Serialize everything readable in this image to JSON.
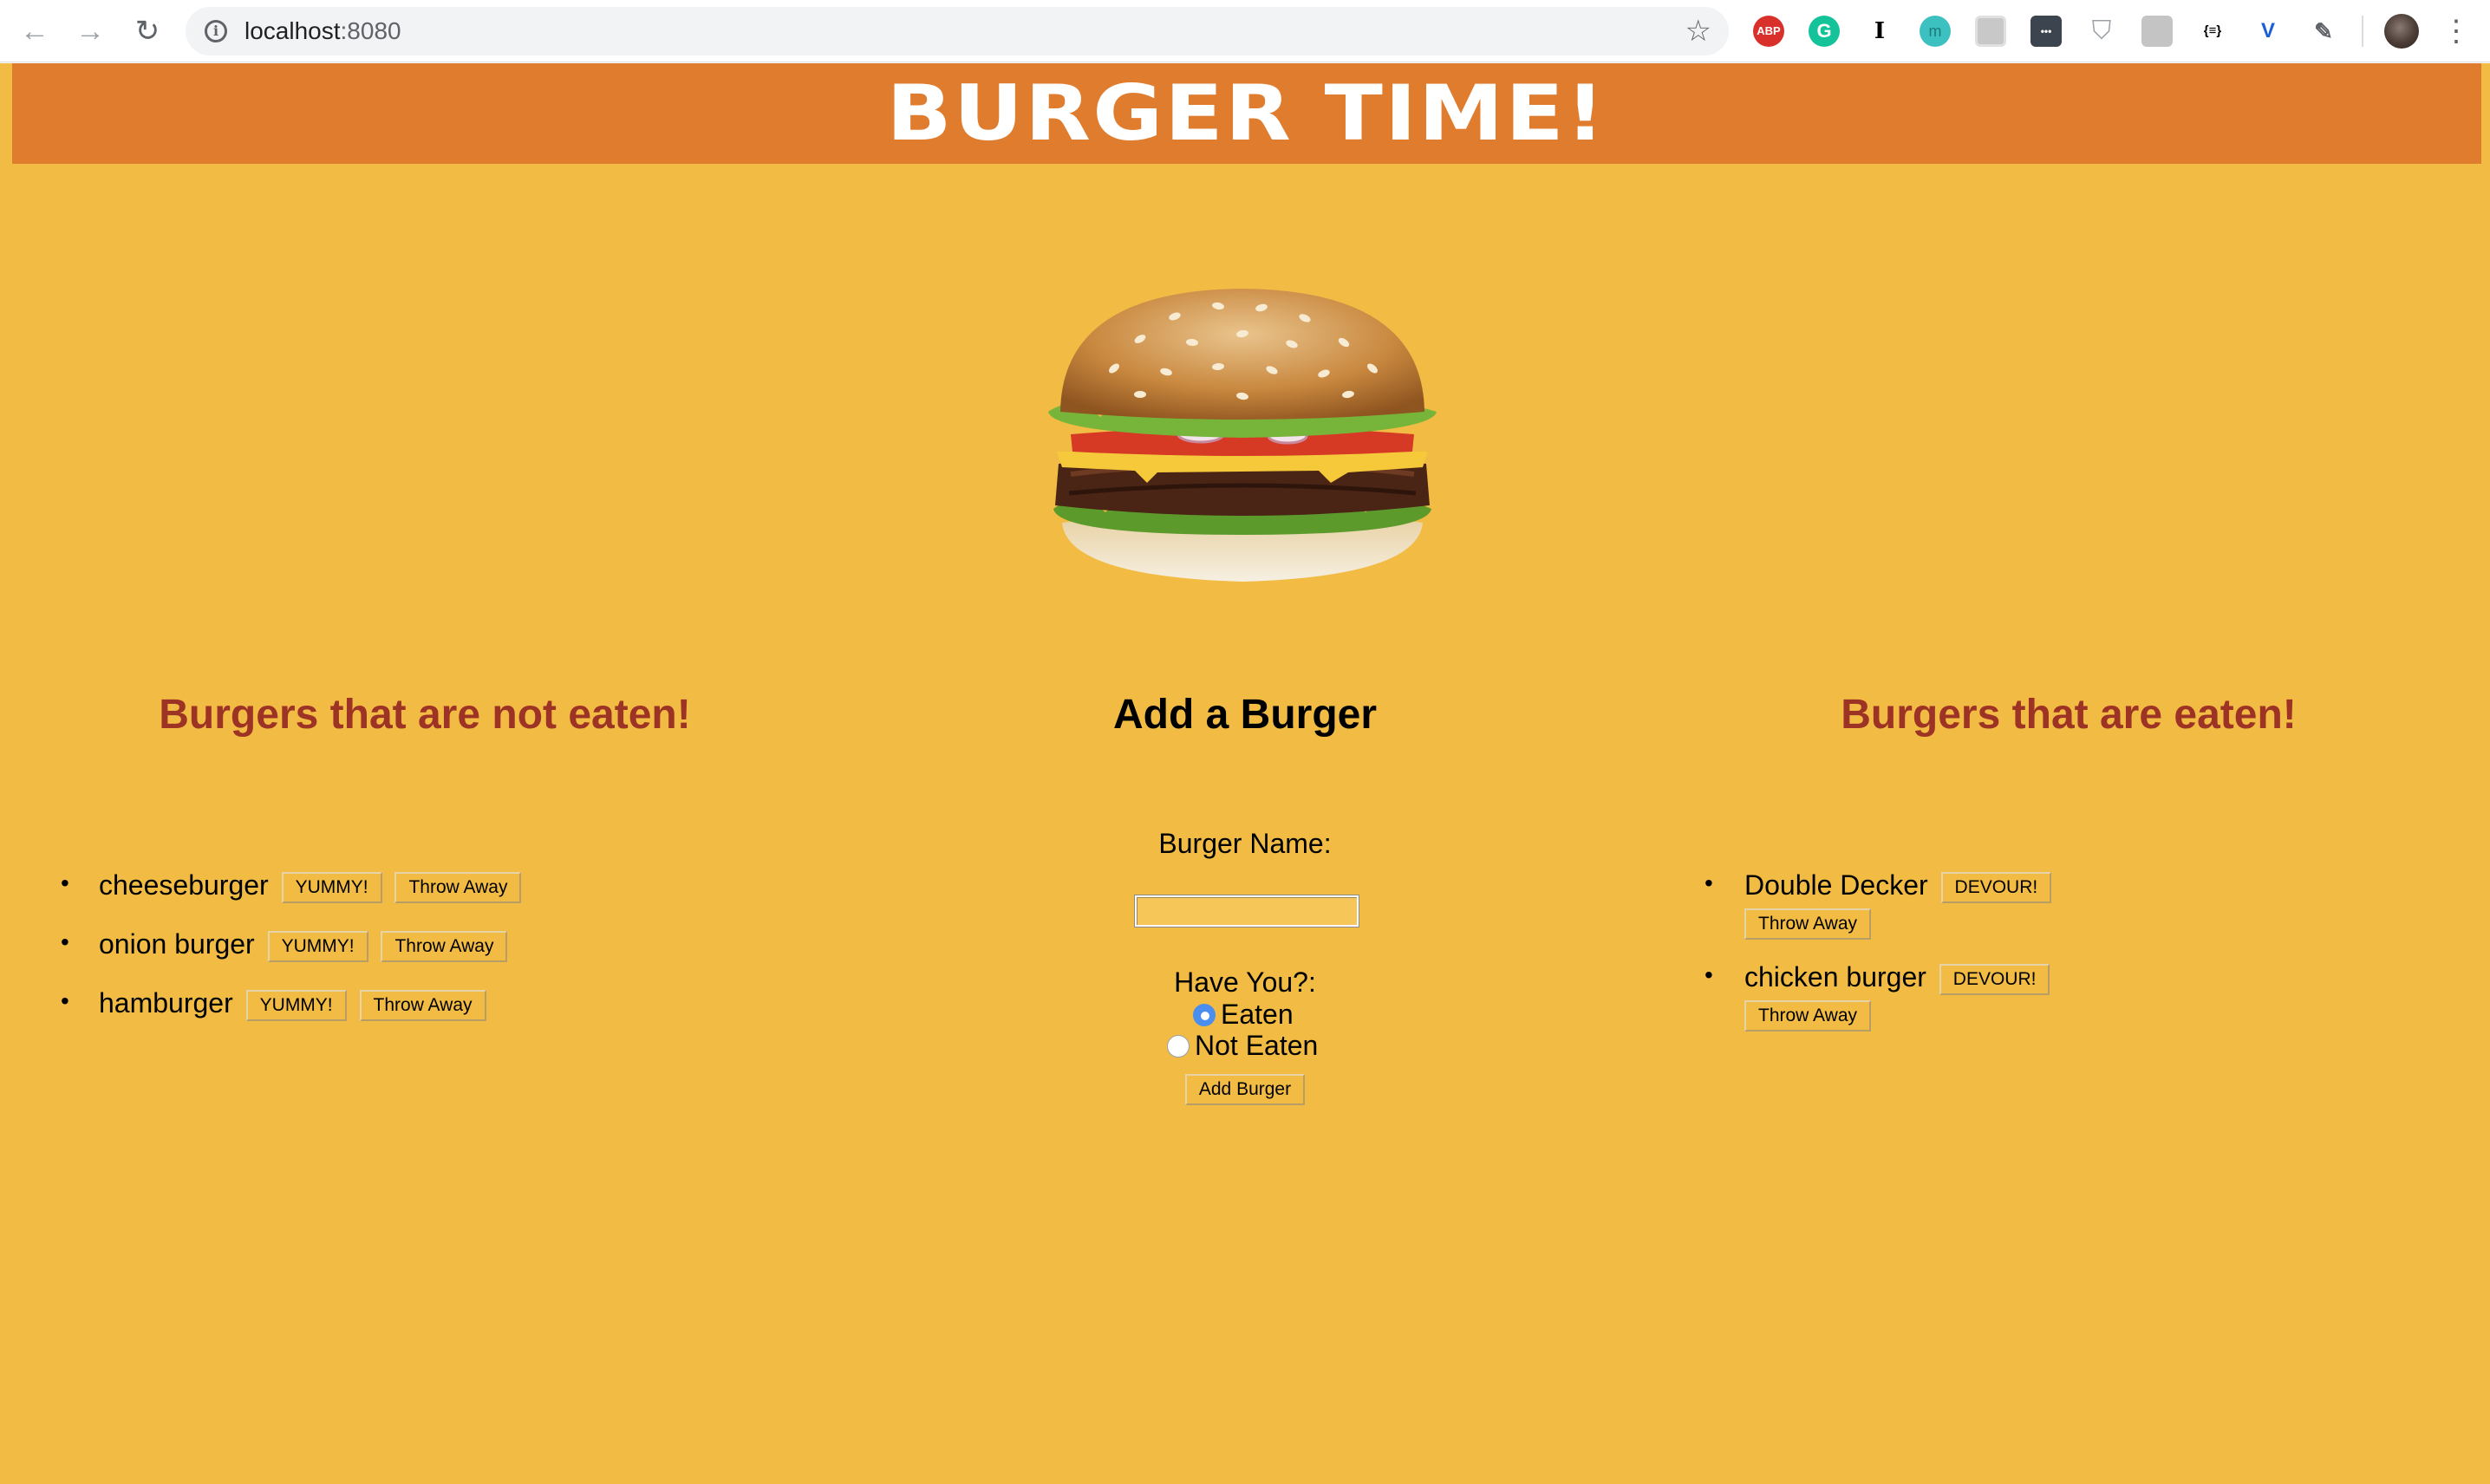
{
  "browser": {
    "url_host": "localhost",
    "url_port": ":8080",
    "extensions": [
      {
        "name": "adblock-plus-icon",
        "label": "ABP",
        "color": "#d9302c"
      },
      {
        "name": "grammarly-icon",
        "label": "G",
        "color": "#15c39a"
      },
      {
        "name": "instapaper-icon",
        "label": "I",
        "color": "#ffffff"
      },
      {
        "name": "mercury-icon",
        "label": "m",
        "color": "#3cc0c0"
      },
      {
        "name": "clipper-icon",
        "label": "",
        "color": "#b0b0b0"
      },
      {
        "name": "dots-extension-icon",
        "label": "•••",
        "color": "#3c4450"
      },
      {
        "name": "shield-extension-icon",
        "label": "",
        "color": "#9aa0a6"
      },
      {
        "name": "hat-extension-icon",
        "label": "",
        "color": "#b5b5b5"
      },
      {
        "name": "json-viewer-icon",
        "label": "{≡}",
        "color": "#ffffff"
      },
      {
        "name": "v-extension-icon",
        "label": "V",
        "color": "#ffffff"
      },
      {
        "name": "eyedropper-icon",
        "label": "",
        "color": "#ffffff"
      }
    ]
  },
  "header": {
    "title": "BURGER TIME!"
  },
  "columns": {
    "not_eaten_title": "Burgers that are not eaten!",
    "add_title": "Add a Burger",
    "eaten_title": "Burgers that are eaten!"
  },
  "not_eaten": [
    {
      "name": "cheeseburger",
      "action": "YUMMY!",
      "discard": "Throw Away"
    },
    {
      "name": "onion burger",
      "action": "YUMMY!",
      "discard": "Throw Away"
    },
    {
      "name": "hamburger",
      "action": "YUMMY!",
      "discard": "Throw Away"
    }
  ],
  "eaten": [
    {
      "name": "Double Decker",
      "action": "DEVOUR!",
      "discard": "Throw Away"
    },
    {
      "name": "chicken burger",
      "action": "DEVOUR!",
      "discard": "Throw Away"
    }
  ],
  "form": {
    "name_label": "Burger Name:",
    "name_value": "",
    "status_label": "Have You?:",
    "option_eaten": "Eaten",
    "option_not_eaten": "Not Eaten",
    "selected": "Eaten",
    "submit_label": "Add Burger"
  },
  "colors": {
    "page_bg": "#f2bc44",
    "banner_bg": "#e07c2e",
    "title_red": "#9c3325"
  },
  "bullet": "•"
}
